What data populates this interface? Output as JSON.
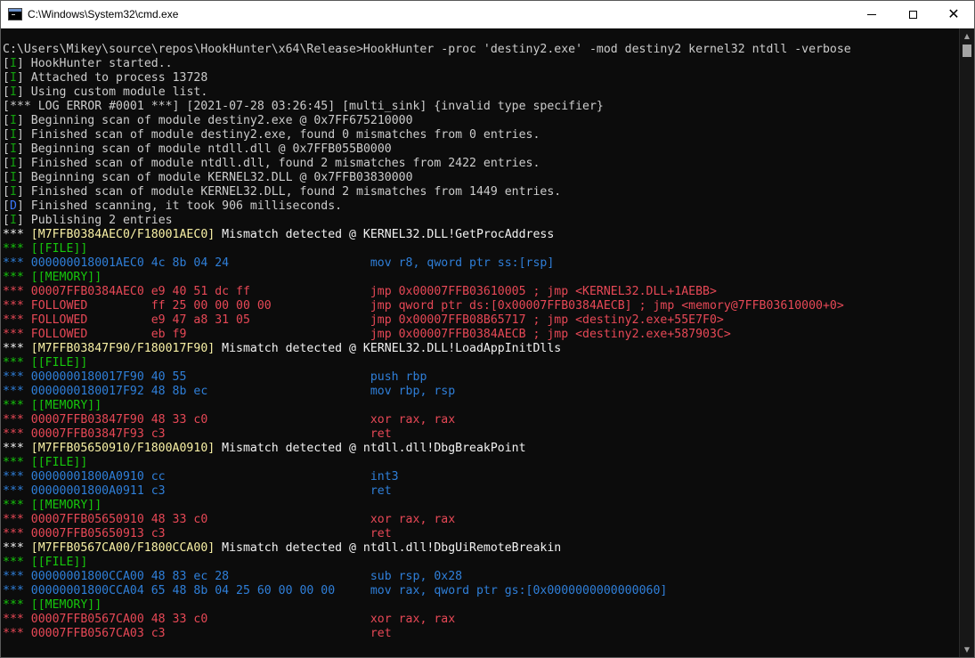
{
  "window": {
    "title": "C:\\Windows\\System32\\cmd.exe",
    "minimize_glyph": "",
    "close_glyph": "✕",
    "scroll_up_glyph": "▲",
    "scroll_down_glyph": "▼"
  },
  "console": {
    "lines": [
      [
        {
          "t": "C:\\Users\\Mikey\\source\\repos\\HookHunter\\x64\\Release>HookHunter -proc 'destiny2.exe' -mod destiny2 kernel32 ntdll -verbose",
          "c": "gray"
        }
      ],
      [
        {
          "t": "[",
          "c": "gray"
        },
        {
          "t": "I",
          "c": "green"
        },
        {
          "t": "] HookHunter started..",
          "c": "gray"
        }
      ],
      [
        {
          "t": "[",
          "c": "gray"
        },
        {
          "t": "I",
          "c": "green"
        },
        {
          "t": "] Attached to process 13728",
          "c": "gray"
        }
      ],
      [
        {
          "t": "[",
          "c": "gray"
        },
        {
          "t": "I",
          "c": "green"
        },
        {
          "t": "] Using custom module list.",
          "c": "gray"
        }
      ],
      [
        {
          "t": "[*** LOG ERROR #0001 ***] [2021-07-28 03:26:45] [multi_sink] {invalid type specifier}",
          "c": "gray"
        }
      ],
      [
        {
          "t": "[",
          "c": "gray"
        },
        {
          "t": "I",
          "c": "green"
        },
        {
          "t": "] Beginning scan of module destiny2.exe @ 0x7FF675210000",
          "c": "gray"
        }
      ],
      [
        {
          "t": "[",
          "c": "gray"
        },
        {
          "t": "I",
          "c": "green"
        },
        {
          "t": "] Finished scan of module destiny2.exe, found 0 mismatches from 0 entries.",
          "c": "gray"
        }
      ],
      [
        {
          "t": "[",
          "c": "gray"
        },
        {
          "t": "I",
          "c": "green"
        },
        {
          "t": "] Beginning scan of module ntdll.dll @ 0x7FFB055B0000",
          "c": "gray"
        }
      ],
      [
        {
          "t": "[",
          "c": "gray"
        },
        {
          "t": "I",
          "c": "green"
        },
        {
          "t": "] Finished scan of module ntdll.dll, found 2 mismatches from 2422 entries.",
          "c": "gray"
        }
      ],
      [
        {
          "t": "[",
          "c": "gray"
        },
        {
          "t": "I",
          "c": "green"
        },
        {
          "t": "] Beginning scan of module KERNEL32.DLL @ 0x7FFB03830000",
          "c": "gray"
        }
      ],
      [
        {
          "t": "[",
          "c": "gray"
        },
        {
          "t": "I",
          "c": "green"
        },
        {
          "t": "] Finished scan of module KERNEL32.DLL, found 2 mismatches from 1449 entries.",
          "c": "gray"
        }
      ],
      [
        {
          "t": "[",
          "c": "gray"
        },
        {
          "t": "D",
          "c": "blue"
        },
        {
          "t": "] Finished scanning, it took 906 milliseconds.",
          "c": "gray"
        }
      ],
      [
        {
          "t": "[",
          "c": "gray"
        },
        {
          "t": "I",
          "c": "green"
        },
        {
          "t": "] Publishing 2 entries",
          "c": "gray"
        }
      ],
      [
        {
          "t": "*** ",
          "c": "white"
        },
        {
          "t": "[M7FFB0384AEC0/F18001AEC0]",
          "c": "yellow"
        },
        {
          "t": " Mismatch detected @ KERNEL32.DLL!GetProcAddress",
          "c": "white"
        }
      ],
      [
        {
          "t": "*** ",
          "c": "lgreen"
        },
        {
          "t": "[[FILE]]",
          "c": "lgreen"
        }
      ],
      [
        {
          "t": "*** ",
          "c": "dblue"
        },
        {
          "t": "000000018001AEC0 4c 8b 04 24                    mov r8, qword ptr ss:[rsp]",
          "c": "dblue"
        }
      ],
      [
        {
          "t": "*** ",
          "c": "lgreen"
        },
        {
          "t": "[[MEMORY]]",
          "c": "lgreen"
        }
      ],
      [
        {
          "t": "*** ",
          "c": "red"
        },
        {
          "t": "00007FFB0384AEC0 e9 40 51 dc ff                 jmp 0x00007FFB03610005 ; jmp <KERNEL32.DLL+1AEBB>",
          "c": "red"
        }
      ],
      [
        {
          "t": "*** ",
          "c": "red"
        },
        {
          "t": "FOLLOWED         ff 25 00 00 00 00              jmp qword ptr ds:[0x00007FFB0384AECB] ; jmp <memory@7FFB03610000+0>",
          "c": "red"
        }
      ],
      [
        {
          "t": "*** ",
          "c": "red"
        },
        {
          "t": "FOLLOWED         e9 47 a8 31 05                 jmp 0x00007FFB08B65717 ; jmp <destiny2.exe+55E7F0>",
          "c": "red"
        }
      ],
      [
        {
          "t": "*** ",
          "c": "red"
        },
        {
          "t": "FOLLOWED         eb f9                          jmp 0x00007FFB0384AECB ; jmp <destiny2.exe+587903C>",
          "c": "red"
        }
      ],
      [
        {
          "t": "*** ",
          "c": "white"
        },
        {
          "t": "[M7FFB03847F90/F180017F90]",
          "c": "yellow"
        },
        {
          "t": " Mismatch detected @ KERNEL32.DLL!LoadAppInitDlls",
          "c": "white"
        }
      ],
      [
        {
          "t": "*** ",
          "c": "lgreen"
        },
        {
          "t": "[[FILE]]",
          "c": "lgreen"
        }
      ],
      [
        {
          "t": "*** ",
          "c": "dblue"
        },
        {
          "t": "0000000180017F90 40 55                          push rbp",
          "c": "dblue"
        }
      ],
      [
        {
          "t": "*** ",
          "c": "dblue"
        },
        {
          "t": "0000000180017F92 48 8b ec                       mov rbp, rsp",
          "c": "dblue"
        }
      ],
      [
        {
          "t": "*** ",
          "c": "lgreen"
        },
        {
          "t": "[[MEMORY]]",
          "c": "lgreen"
        }
      ],
      [
        {
          "t": "*** ",
          "c": "red"
        },
        {
          "t": "00007FFB03847F90 48 33 c0                       xor rax, rax",
          "c": "red"
        }
      ],
      [
        {
          "t": "*** ",
          "c": "red"
        },
        {
          "t": "00007FFB03847F93 c3                             ret",
          "c": "red"
        }
      ],
      [
        {
          "t": "*** ",
          "c": "white"
        },
        {
          "t": "[M7FFB05650910/F1800A0910]",
          "c": "yellow"
        },
        {
          "t": " Mismatch detected @ ntdll.dll!DbgBreakPoint",
          "c": "white"
        }
      ],
      [
        {
          "t": "*** ",
          "c": "lgreen"
        },
        {
          "t": "[[FILE]]",
          "c": "lgreen"
        }
      ],
      [
        {
          "t": "*** ",
          "c": "dblue"
        },
        {
          "t": "00000001800A0910 cc                             int3",
          "c": "dblue"
        }
      ],
      [
        {
          "t": "*** ",
          "c": "dblue"
        },
        {
          "t": "00000001800A0911 c3                             ret",
          "c": "dblue"
        }
      ],
      [
        {
          "t": "*** ",
          "c": "lgreen"
        },
        {
          "t": "[[MEMORY]]",
          "c": "lgreen"
        }
      ],
      [
        {
          "t": "*** ",
          "c": "red"
        },
        {
          "t": "00007FFB05650910 48 33 c0                       xor rax, rax",
          "c": "red"
        }
      ],
      [
        {
          "t": "*** ",
          "c": "red"
        },
        {
          "t": "00007FFB05650913 c3                             ret",
          "c": "red"
        }
      ],
      [
        {
          "t": "*** ",
          "c": "white"
        },
        {
          "t": "[M7FFB0567CA00/F1800CCA00]",
          "c": "yellow"
        },
        {
          "t": " Mismatch detected @ ntdll.dll!DbgUiRemoteBreakin",
          "c": "white"
        }
      ],
      [
        {
          "t": "*** ",
          "c": "lgreen"
        },
        {
          "t": "[[FILE]]",
          "c": "lgreen"
        }
      ],
      [
        {
          "t": "*** ",
          "c": "dblue"
        },
        {
          "t": "00000001800CCA00 48 83 ec 28                    sub rsp, 0x28",
          "c": "dblue"
        }
      ],
      [
        {
          "t": "*** ",
          "c": "dblue"
        },
        {
          "t": "00000001800CCA04 65 48 8b 04 25 60 00 00 00     mov rax, qword ptr gs:[0x0000000000000060]",
          "c": "dblue"
        }
      ],
      [
        {
          "t": "*** ",
          "c": "lgreen"
        },
        {
          "t": "[[MEMORY]]",
          "c": "lgreen"
        }
      ],
      [
        {
          "t": "*** ",
          "c": "red"
        },
        {
          "t": "00007FFB0567CA00 48 33 c0                       xor rax, rax",
          "c": "red"
        }
      ],
      [
        {
          "t": "*** ",
          "c": "red"
        },
        {
          "t": "00007FFB0567CA03 c3                             ret",
          "c": "red"
        }
      ]
    ]
  },
  "colors": {
    "background": "#0c0c0c",
    "gray": "#cccccc",
    "green": "#13a10e",
    "light_green": "#16c60c",
    "blue": "#3b78ff",
    "dark_blue": "#2f7fd9",
    "red": "#e74856",
    "yellow": "#f9f1a5",
    "white": "#f2f2f2"
  }
}
